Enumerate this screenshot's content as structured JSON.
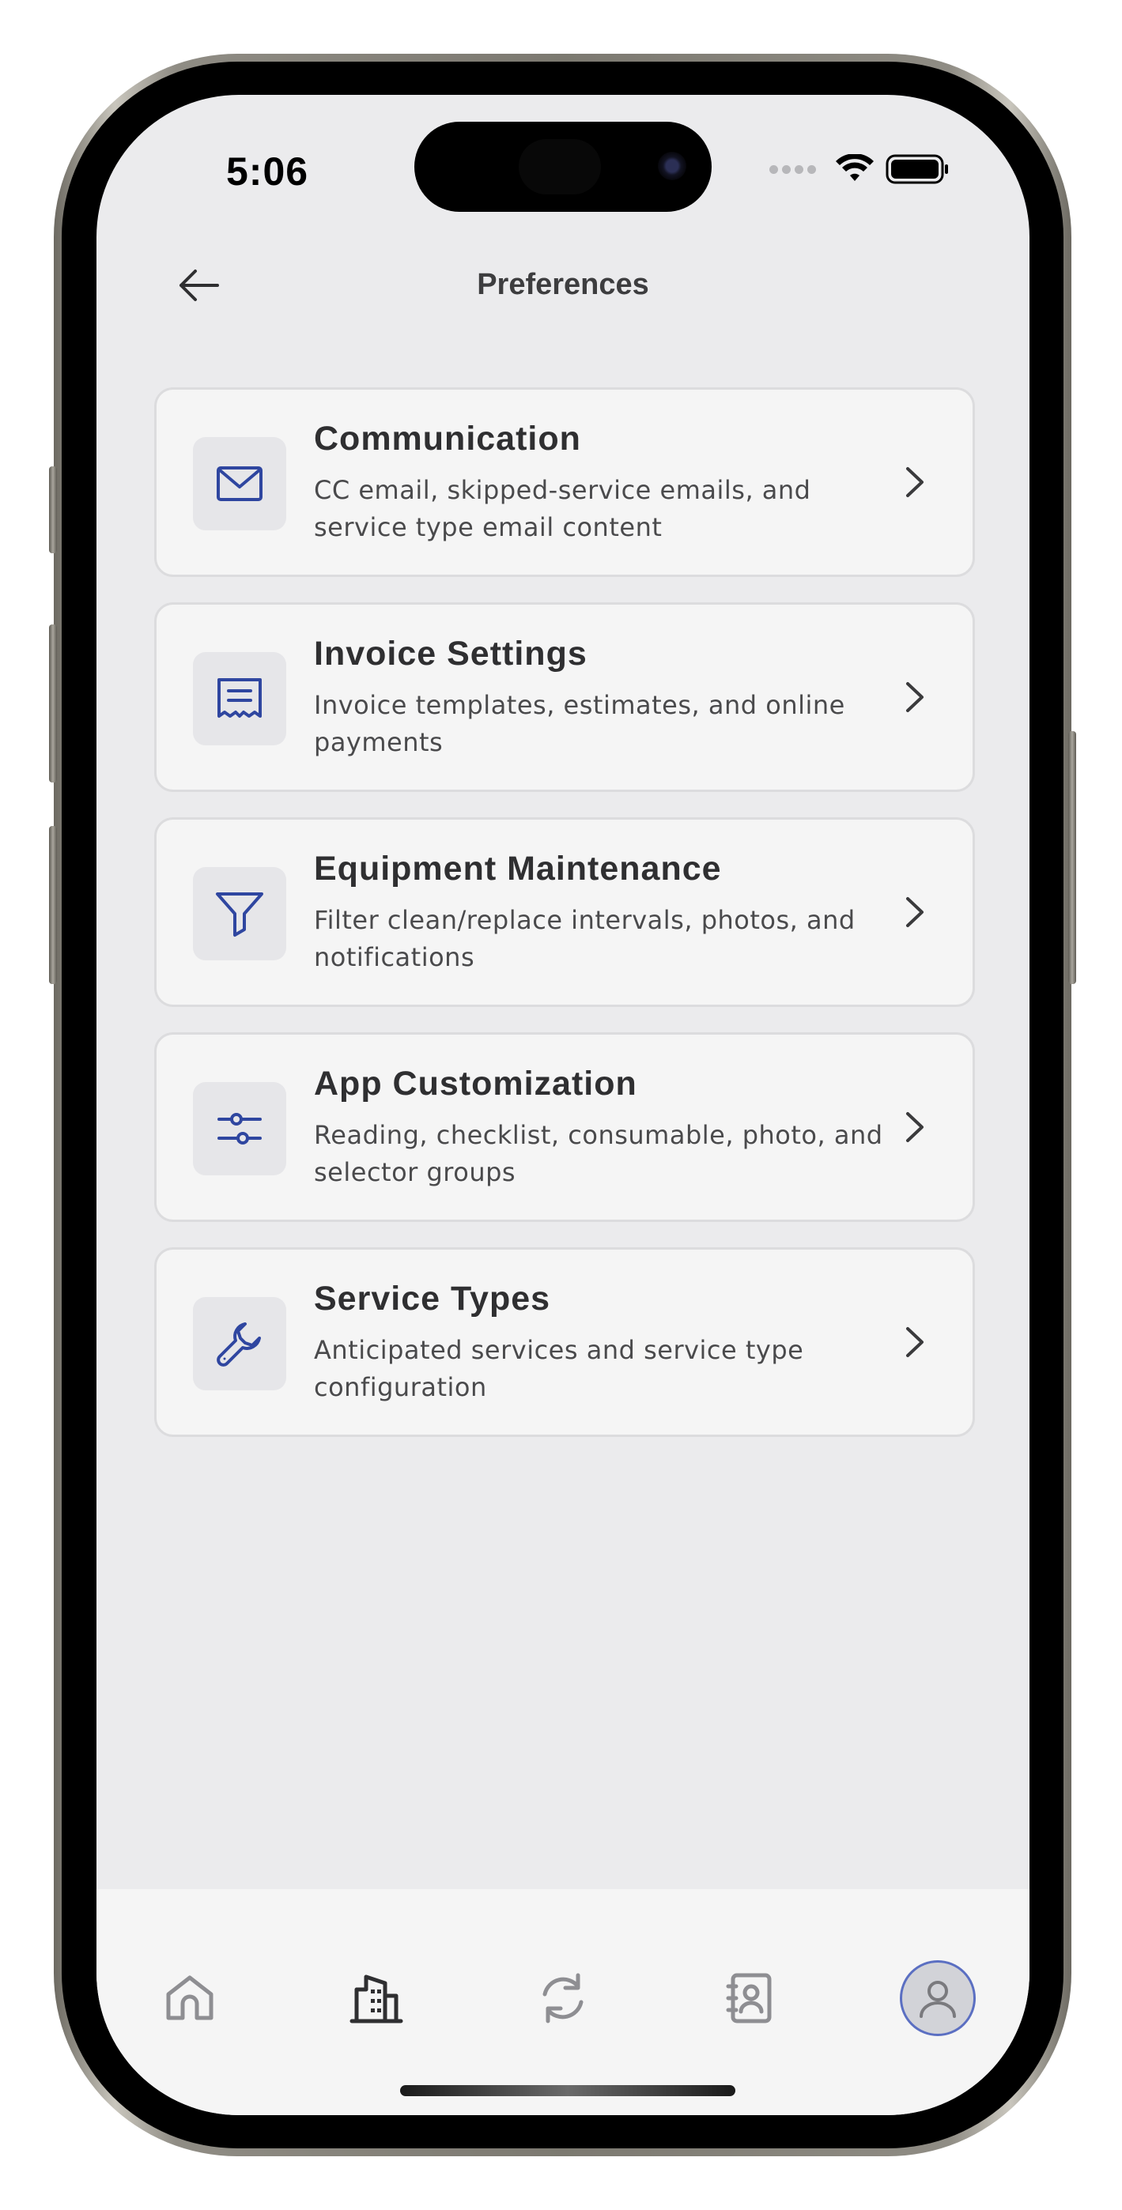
{
  "status_bar": {
    "time": "5:06"
  },
  "header": {
    "title": "Preferences",
    "back_icon": "arrow-left-icon"
  },
  "preferences": [
    {
      "title": "Communication",
      "description": "CC email, skipped-service emails, and service type email content",
      "icon": "envelope-icon"
    },
    {
      "title": "Invoice Settings",
      "description": "Invoice templates, estimates, and online payments",
      "icon": "receipt-icon"
    },
    {
      "title": "Equipment Maintenance",
      "description": "Filter clean/replace intervals, photos, and notifications",
      "icon": "filter-icon"
    },
    {
      "title": "App Customization",
      "description": "Reading, checklist, consumable, photo, and selector groups",
      "icon": "sliders-icon"
    },
    {
      "title": "Service Types",
      "description": "Anticipated services and service type configuration",
      "icon": "wrench-icon"
    }
  ],
  "tab_bar": {
    "items": [
      {
        "icon": "home-icon",
        "active": false
      },
      {
        "icon": "building-icon",
        "active": false
      },
      {
        "icon": "sync-icon",
        "active": false
      },
      {
        "icon": "contacts-icon",
        "active": false
      },
      {
        "icon": "user-avatar-icon",
        "active": true
      }
    ]
  },
  "colors": {
    "accent": "#2f46a0",
    "background": "#ebebed",
    "card": "#f5f5f5",
    "avatar_ring": "#5b6fc2"
  }
}
